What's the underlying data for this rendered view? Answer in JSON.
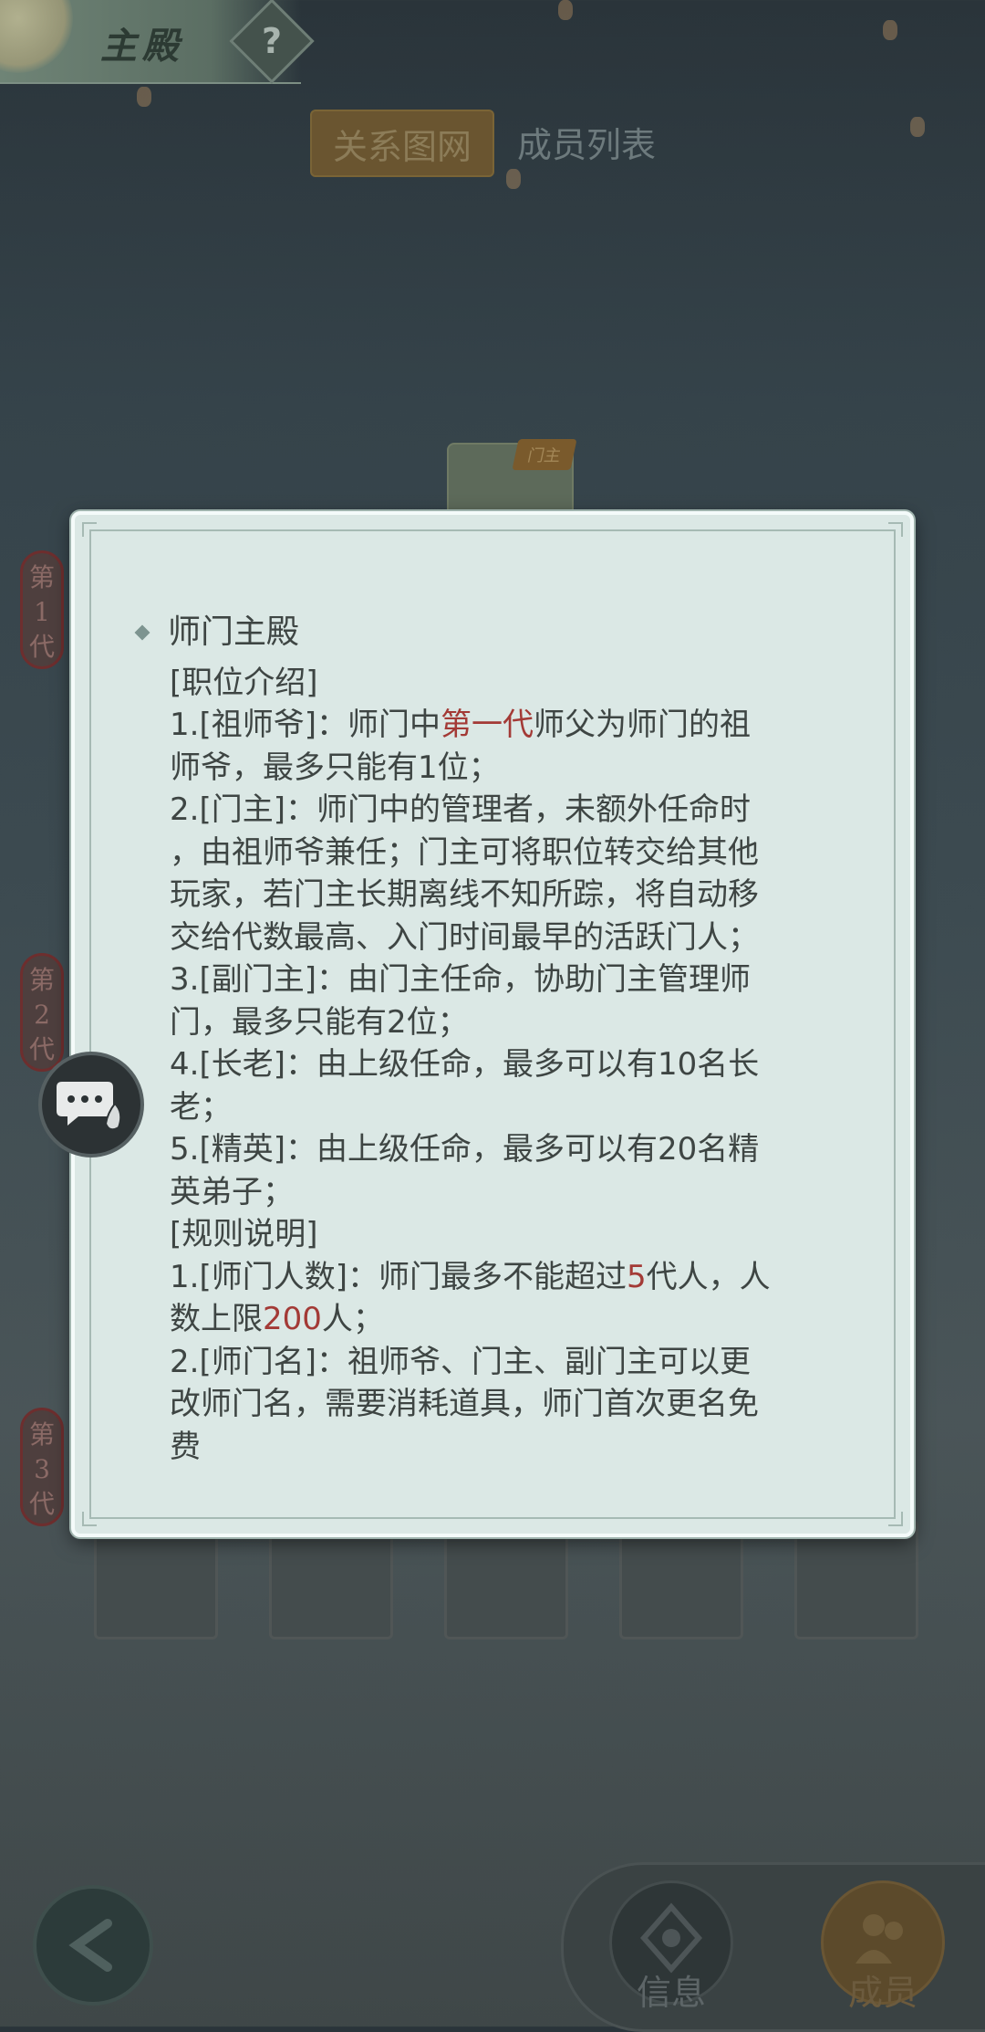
{
  "header": {
    "title": "主殿",
    "help_icon": "?"
  },
  "tabs": [
    {
      "label": "关系图网",
      "active": true
    },
    {
      "label": "成员列表",
      "active": false
    }
  ],
  "generations": [
    "第1代",
    "第2代",
    "第3代"
  ],
  "master_badge": "门主",
  "modal": {
    "section_title": "师门主殿",
    "lines": [
      {
        "parts": [
          {
            "t": "[职位介绍]"
          }
        ]
      },
      {
        "parts": [
          {
            "t": "1.[祖师爷]：师门中"
          },
          {
            "t": "第一代",
            "red": true
          },
          {
            "t": "师父为师门的祖"
          }
        ]
      },
      {
        "parts": [
          {
            "t": "师爷，最多只能有1位；"
          }
        ]
      },
      {
        "parts": [
          {
            "t": "2.[门主]：师门中的管理者，未额外任命时"
          }
        ]
      },
      {
        "parts": [
          {
            "t": "，由祖师爷兼任；门主可将职位转交给其他"
          }
        ]
      },
      {
        "parts": [
          {
            "t": "玩家，若门主长期离线不知所踪，将自动移"
          }
        ]
      },
      {
        "parts": [
          {
            "t": "交给代数最高、入门时间最早的活跃门人；"
          }
        ]
      },
      {
        "parts": [
          {
            "t": "3.[副门主]：由门主任命，协助门主管理师"
          }
        ]
      },
      {
        "parts": [
          {
            "t": "门，最多只能有2位；"
          }
        ]
      },
      {
        "parts": [
          {
            "t": "4.[长老]：由上级任命，最多可以有10名长"
          }
        ]
      },
      {
        "parts": [
          {
            "t": "老；"
          }
        ]
      },
      {
        "parts": [
          {
            "t": "5.[精英]：由上级任命，最多可以有20名精"
          }
        ]
      },
      {
        "parts": [
          {
            "t": "英弟子；"
          }
        ]
      },
      {
        "parts": [
          {
            "t": "[规则说明]"
          }
        ]
      },
      {
        "parts": [
          {
            "t": "1.[师门人数]：师门最多不能超过"
          },
          {
            "t": "5",
            "red": true
          },
          {
            "t": "代人，人"
          }
        ]
      },
      {
        "parts": [
          {
            "t": "数上限"
          },
          {
            "t": "200",
            "red": true
          },
          {
            "t": "人；"
          }
        ]
      },
      {
        "parts": [
          {
            "t": "2.[师门名]：祖师爷、门主、副门主可以更"
          }
        ]
      },
      {
        "parts": [
          {
            "t": "改师门名，需要消耗道具，师门首次更名免"
          }
        ]
      },
      {
        "parts": [
          {
            "t": "费"
          }
        ]
      }
    ]
  },
  "bottom_nav": {
    "info_label": "信息",
    "members_label": "成员"
  },
  "colors": {
    "modal_bg": "#dbe8e5",
    "highlight_red": "#a33a36",
    "text": "#3e4543"
  },
  "icons": [
    "help-icon",
    "chat-icon",
    "back-icon",
    "info-icon",
    "members-icon",
    "diamond-bullet-icon"
  ]
}
